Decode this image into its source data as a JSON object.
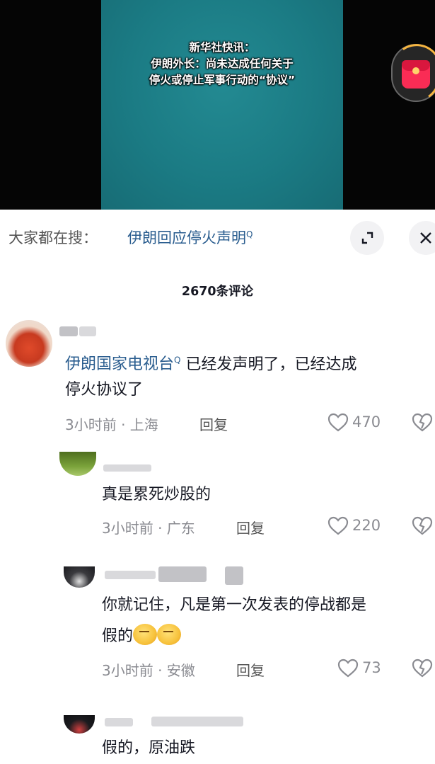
{
  "video": {
    "caption_lines": [
      "新华社快讯：",
      "伊朗外长：尚未达成任何关于",
      "停火或停止军事行动的“协议”"
    ]
  },
  "search": {
    "prefix": "大家都在搜：",
    "term": "伊朗回应停火声明",
    "term_suffix": "Q"
  },
  "comments_header": {
    "count_label": "2670条评论"
  },
  "comments": [
    {
      "mention": "伊朗国家电视台",
      "mention_suffix": "Q",
      "text_line1": " 已经发声明了，已经达成",
      "text_line2": "停火协议了",
      "time": "3小时前 · 上海",
      "reply": "回复",
      "likes": "470"
    },
    {
      "text": "真是累死炒股的",
      "time": "3小时前 · 广东",
      "reply": "回复",
      "likes": "220"
    },
    {
      "text_line1": "你就记住，凡是第一次发表的停战都是",
      "text_line2": "假的",
      "time": "3小时前 · 安徽",
      "reply": "回复",
      "likes": "73"
    },
    {
      "text": "假的，原油跌"
    }
  ],
  "colors": {
    "link": "#2a5d8f",
    "accent_red": "#fa2c55",
    "video_bg": "#1b7b84"
  },
  "icons": [
    "red-packet-icon",
    "expand-icon",
    "close-icon",
    "heart-icon",
    "dislike-icon",
    "search-q-icon",
    "emoji-icon"
  ]
}
